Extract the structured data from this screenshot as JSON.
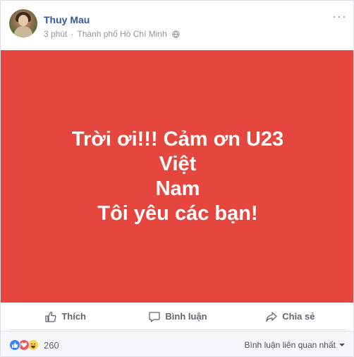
{
  "post": {
    "author": "Thuy Mau",
    "time": "3 phút",
    "separator": "·",
    "location": "Thành phố Hồ Chí Minh",
    "more_icon": "ellipsis-icon",
    "background_color": "#e5463d",
    "text_lines": [
      "Trời ơi!!! Cảm ơn U23 Việt",
      "Nam",
      "Tôi yêu các bạn!"
    ]
  },
  "actions": {
    "like_label": "Thích",
    "comment_label": "Bình luận",
    "share_label": "Chia sẻ"
  },
  "reactions": {
    "icons": [
      "like-icon",
      "love-icon",
      "haha-icon"
    ],
    "count": "260"
  },
  "comments": {
    "sort_label": "Bình luận liên quan nhất"
  },
  "colors": {
    "link": "#365899",
    "meta": "#90949c",
    "like": "#4080ff",
    "love": "#f25268",
    "haha": "#fcd450"
  }
}
